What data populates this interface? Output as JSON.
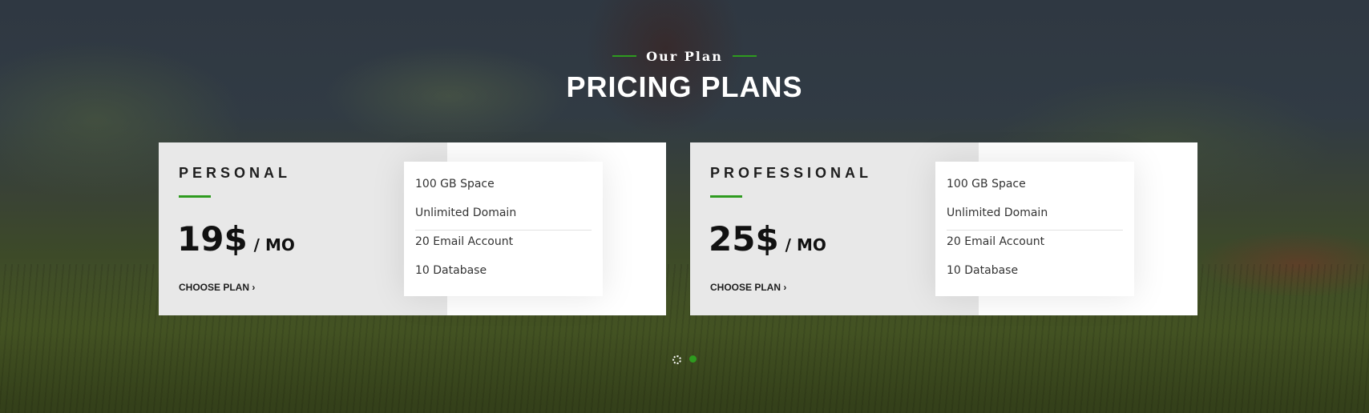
{
  "section": {
    "subtitle": "Our Plan",
    "title": "PRICING PLANS"
  },
  "plans": [
    {
      "name": "PERSONAL",
      "price": "19$",
      "period": "/ MO",
      "cta": "CHOOSE PLAN ›",
      "features": [
        "100 GB Space",
        "Unlimited Domain",
        "20 Email Account",
        "10 Database"
      ]
    },
    {
      "name": "PROFESSIONAL",
      "price": "25$",
      "period": "/ MO",
      "cta": "CHOOSE PLAN ›",
      "features": [
        "100 GB Space",
        "Unlimited Domain",
        "20 Email Account",
        "10 Database"
      ]
    }
  ],
  "pagination": {
    "count": 2,
    "active_index": 1
  },
  "colors": {
    "accent": "#2e9b1f",
    "card_left": "#e8e8e8",
    "card_right": "#ffffff",
    "text": "#1d1d1d"
  }
}
